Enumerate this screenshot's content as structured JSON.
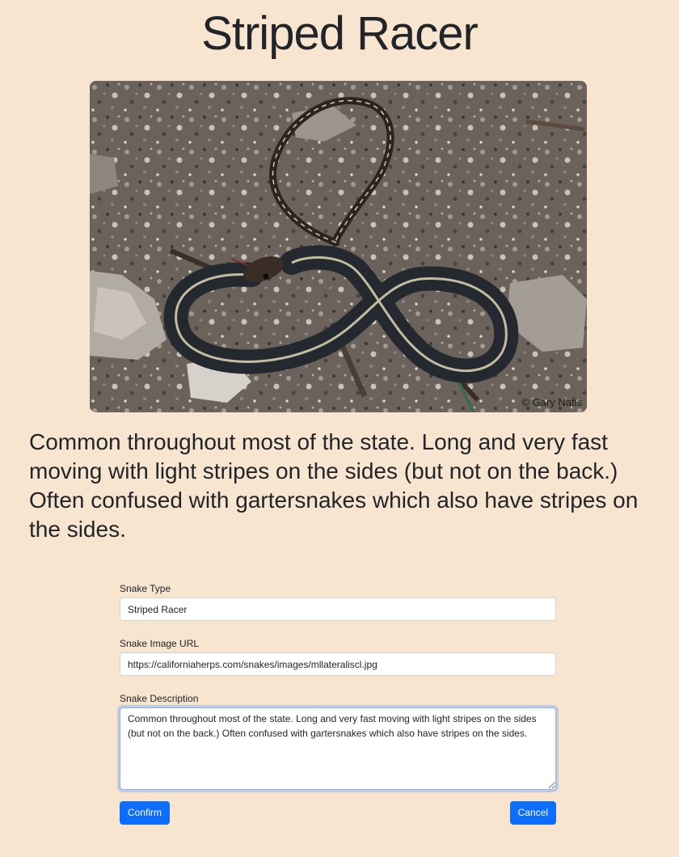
{
  "snake": {
    "title": "Striped Racer",
    "image_credit": "© Gary Nafis",
    "description": "Common throughout most of the state. Long and very fast moving with light stripes on the sides (but not on the back.) Often confused with gartersnakes which also have stripes on the sides."
  },
  "form": {
    "type_label": "Snake Type",
    "type_value": "Striped Racer",
    "image_url_label": "Snake Image URL",
    "image_url_value": "https://californiaherps.com/snakes/images/mllateraliscl.jpg",
    "description_label": "Snake Description",
    "description_value": "Common throughout most of the state. Long and very fast moving with light stripes on the sides (but not on the back.) Often confused with gartersnakes which also have stripes on the sides.",
    "confirm_label": "Confirm",
    "cancel_label": "Cancel"
  },
  "colors": {
    "background": "#f8e5cf",
    "primary_button": "#0d6efd"
  }
}
